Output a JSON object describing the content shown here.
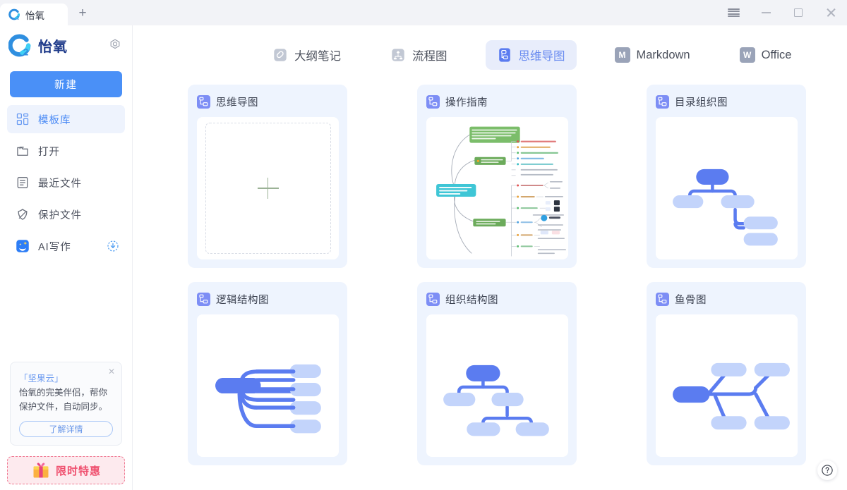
{
  "window": {
    "tab_title": "怡氧",
    "new_tab_label": "+",
    "menu_icon": "hamburger-menu-icon",
    "minimize_icon": "minimize-icon",
    "maximize_icon": "maximize-icon",
    "close_icon": "close-icon"
  },
  "sidebar": {
    "brand_name": "怡氧",
    "settings_icon": "gear-icon",
    "new_button_label": "新建",
    "items": [
      {
        "label": "模板库",
        "icon": "template-grid-icon",
        "active": true
      },
      {
        "label": "打开",
        "icon": "folder-open-icon",
        "active": false
      },
      {
        "label": "最近文件",
        "icon": "recent-document-icon",
        "active": false
      },
      {
        "label": "保护文件",
        "icon": "shield-protect-icon",
        "active": false
      },
      {
        "label": "AI写作",
        "icon": "ai-writing-icon",
        "active": false,
        "badge_icon": "download-circle-icon"
      }
    ],
    "promo": {
      "title": "「坚果云」",
      "text": "怡氧的完美伴侣，帮你保护文件，自动同步。",
      "button_label": "了解详情",
      "close_icon": "close-icon"
    },
    "sale": {
      "label": "限时特惠",
      "icon": "gift-icon"
    }
  },
  "top_tabs": [
    {
      "label": "大纲笔记",
      "icon": "outline-note-icon",
      "active": false
    },
    {
      "label": "流程图",
      "icon": "flowchart-icon",
      "active": false
    },
    {
      "label": "思维导图",
      "icon": "mindmap-icon",
      "active": true
    },
    {
      "label": "Markdown",
      "icon": "markdown-icon",
      "glyph": "M",
      "active": false
    },
    {
      "label": "Office",
      "icon": "office-icon",
      "glyph": "W",
      "active": false
    }
  ],
  "templates": [
    {
      "title": "思维导图",
      "icon": "mindmap-icon",
      "thumb": "create-new-placeholder"
    },
    {
      "title": "操作指南",
      "icon": "mindmap-icon",
      "thumb": "guide-mindmap-preview"
    },
    {
      "title": "目录组织图",
      "icon": "mindmap-icon",
      "thumb": "directory-org-chart"
    },
    {
      "title": "逻辑结构图",
      "icon": "mindmap-icon",
      "thumb": "logic-structure-chart"
    },
    {
      "title": "组织结构图",
      "icon": "mindmap-icon",
      "thumb": "org-structure-chart"
    },
    {
      "title": "鱼骨图",
      "icon": "mindmap-icon",
      "thumb": "fishbone-chart"
    }
  ],
  "help": {
    "icon": "help-circle-icon",
    "label": "?"
  },
  "colors": {
    "accent": "#4a90f7",
    "active_tab_bg": "#e8edfb",
    "active_tab_text": "#6a8cf0",
    "card_bg": "#eef4fe",
    "node_dark": "#5b7cf0",
    "node_light": "#c3d4fb",
    "sale_text": "#ef4f6e",
    "sale_bg": "#fdeaee"
  }
}
